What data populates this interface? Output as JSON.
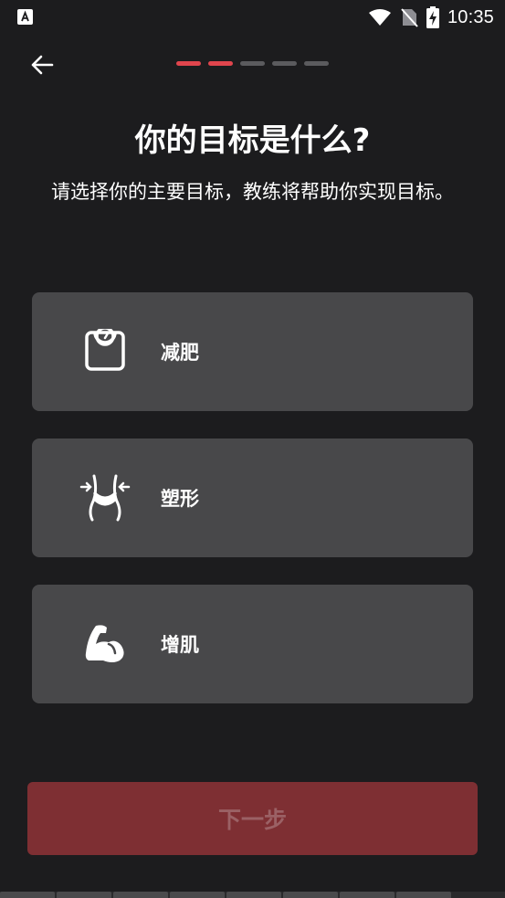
{
  "status_bar": {
    "time": "10:35",
    "icons": [
      "app-notification-icon",
      "wifi-icon",
      "no-sim-icon",
      "battery-charging-icon"
    ]
  },
  "header": {
    "back_icon": "arrow-left-icon",
    "progress": {
      "total_steps": 5,
      "current_step": 2
    }
  },
  "title": "你的目标是什么?",
  "subtitle": "请选择你的主要目标，教练将帮助你实现目标。",
  "options": [
    {
      "label": "减肥",
      "icon": "weight-scale-icon"
    },
    {
      "label": "塑形",
      "icon": "waist-shaping-icon"
    },
    {
      "label": "增肌",
      "icon": "flexed-arm-icon"
    }
  ],
  "next_button": {
    "label": "下一步"
  },
  "colors": {
    "background": "#1c1c1e",
    "card": "#48484a",
    "accent": "#e0454d",
    "button_disabled": "#7e2f33"
  }
}
